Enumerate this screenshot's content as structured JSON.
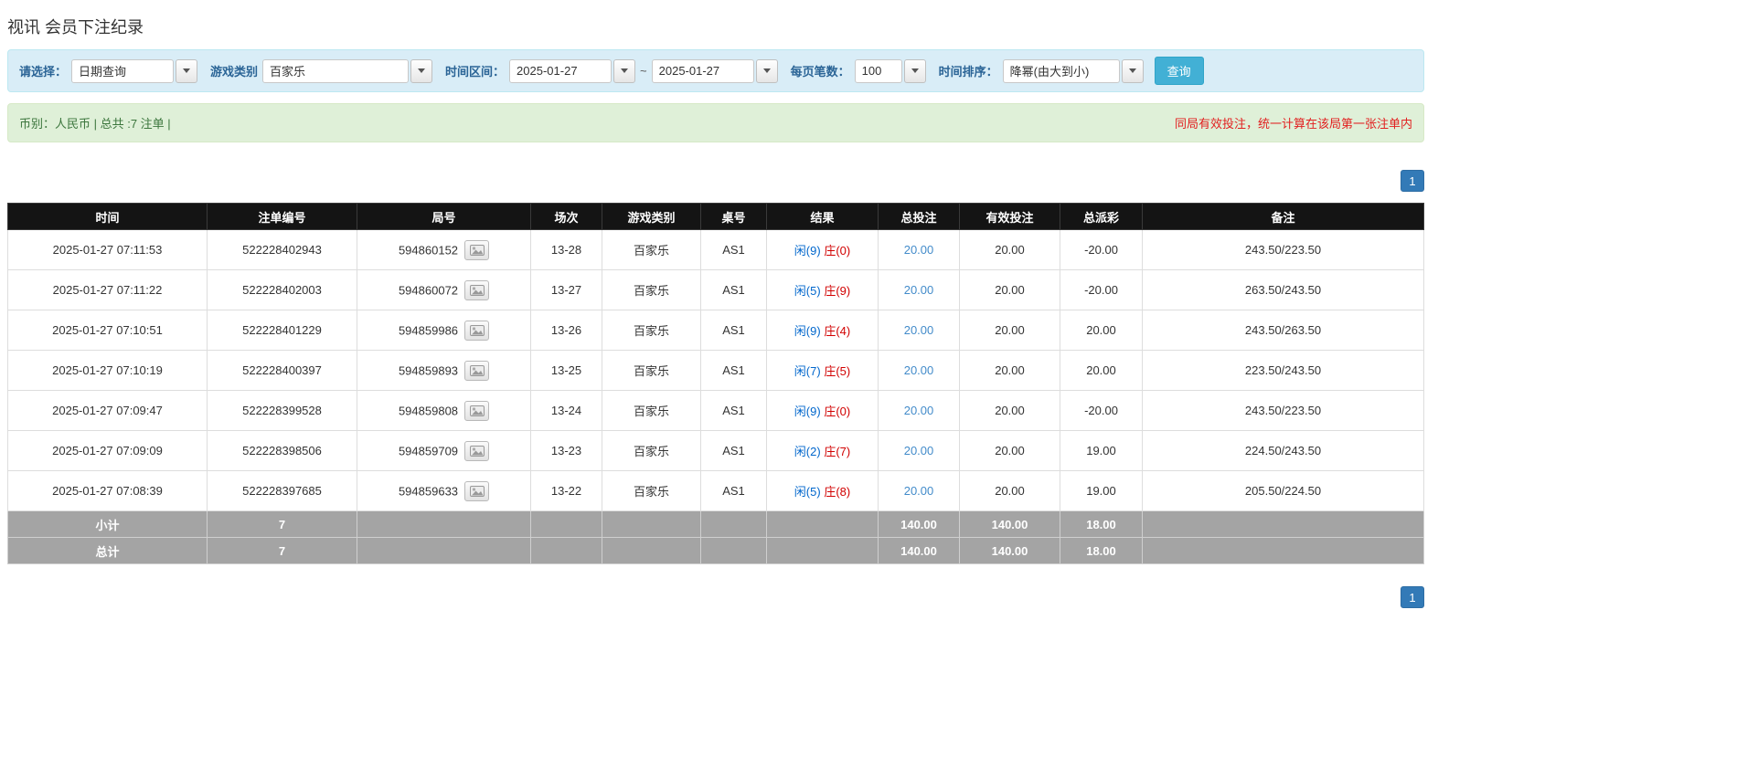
{
  "page": {
    "title": "视讯 会员下注纪录"
  },
  "filter_bar": {
    "select_label": "请选择：",
    "select_value": "日期查询",
    "game_type_label": "游戏类别",
    "game_type_value": "百家乐",
    "time_range_label": "时间区间：",
    "date_from": "2025-01-27",
    "range_separator": "~",
    "date_to": "2025-01-27",
    "page_size_label": "每页笔数：",
    "page_size_value": "100",
    "time_sort_label": "时间排序：",
    "time_sort_value": "降幂(由大到小)",
    "search_button_label": "查询"
  },
  "summary_bar": {
    "currency_info": "币别：人民币 | 总共 :7 注单 |",
    "notice": "同局有效投注，统一计算在该局第一张注单内"
  },
  "pagination": {
    "current_page": "1"
  },
  "icons": {
    "combo_dropdown": "chevron-down-icon",
    "round_detail": "cards-icon"
  },
  "colors": {
    "header_bg": "#141414",
    "footer_bg": "#a4a4a4",
    "link_blue": "#428bca",
    "negative_red": "#e02b2b",
    "player_blue": "#0066cc",
    "banker_red": "#d10000",
    "filter_bg": "#d9edf7",
    "summary_bg": "#dff0d8",
    "button_blue": "#42b0d5",
    "pager_blue": "#337ab7"
  },
  "table": {
    "headers": [
      "时间",
      "注单编号",
      "局号",
      "场次",
      "游戏类别",
      "桌号",
      "结果",
      "总投注",
      "有效投注",
      "总派彩",
      "备注"
    ],
    "rows": [
      {
        "time": "2025-01-27 07:11:53",
        "bet_no": "522228402943",
        "round_no": "594860152",
        "session": "13-28",
        "game": "百家乐",
        "table_no": "AS1",
        "result_player": "闲(9)",
        "result_banker": "庄(0)",
        "total_bet": "20.00",
        "valid_bet": "20.00",
        "payout": "-20.00",
        "note": "243.50/223.50"
      },
      {
        "time": "2025-01-27 07:11:22",
        "bet_no": "522228402003",
        "round_no": "594860072",
        "session": "13-27",
        "game": "百家乐",
        "table_no": "AS1",
        "result_player": "闲(5)",
        "result_banker": "庄(9)",
        "total_bet": "20.00",
        "valid_bet": "20.00",
        "payout": "-20.00",
        "note": "263.50/243.50"
      },
      {
        "time": "2025-01-27 07:10:51",
        "bet_no": "522228401229",
        "round_no": "594859986",
        "session": "13-26",
        "game": "百家乐",
        "table_no": "AS1",
        "result_player": "闲(9)",
        "result_banker": "庄(4)",
        "total_bet": "20.00",
        "valid_bet": "20.00",
        "payout": "20.00",
        "note": "243.50/263.50"
      },
      {
        "time": "2025-01-27 07:10:19",
        "bet_no": "522228400397",
        "round_no": "594859893",
        "session": "13-25",
        "game": "百家乐",
        "table_no": "AS1",
        "result_player": "闲(7)",
        "result_banker": "庄(5)",
        "total_bet": "20.00",
        "valid_bet": "20.00",
        "payout": "20.00",
        "note": "223.50/243.50"
      },
      {
        "time": "2025-01-27 07:09:47",
        "bet_no": "522228399528",
        "round_no": "594859808",
        "session": "13-24",
        "game": "百家乐",
        "table_no": "AS1",
        "result_player": "闲(9)",
        "result_banker": "庄(0)",
        "total_bet": "20.00",
        "valid_bet": "20.00",
        "payout": "-20.00",
        "note": "243.50/223.50"
      },
      {
        "time": "2025-01-27 07:09:09",
        "bet_no": "522228398506",
        "round_no": "594859709",
        "session": "13-23",
        "game": "百家乐",
        "table_no": "AS1",
        "result_player": "闲(2)",
        "result_banker": "庄(7)",
        "total_bet": "20.00",
        "valid_bet": "20.00",
        "payout": "19.00",
        "note": "224.50/243.50"
      },
      {
        "time": "2025-01-27 07:08:39",
        "bet_no": "522228397685",
        "round_no": "594859633",
        "session": "13-22",
        "game": "百家乐",
        "table_no": "AS1",
        "result_player": "闲(5)",
        "result_banker": "庄(8)",
        "total_bet": "20.00",
        "valid_bet": "20.00",
        "payout": "19.00",
        "note": "205.50/224.50"
      }
    ],
    "subtotal": {
      "label": "小计",
      "count": "7",
      "total_bet": "140.00",
      "valid_bet": "140.00",
      "payout": "18.00"
    },
    "total": {
      "label": "总计",
      "count": "7",
      "total_bet": "140.00",
      "valid_bet": "140.00",
      "payout": "18.00"
    }
  }
}
